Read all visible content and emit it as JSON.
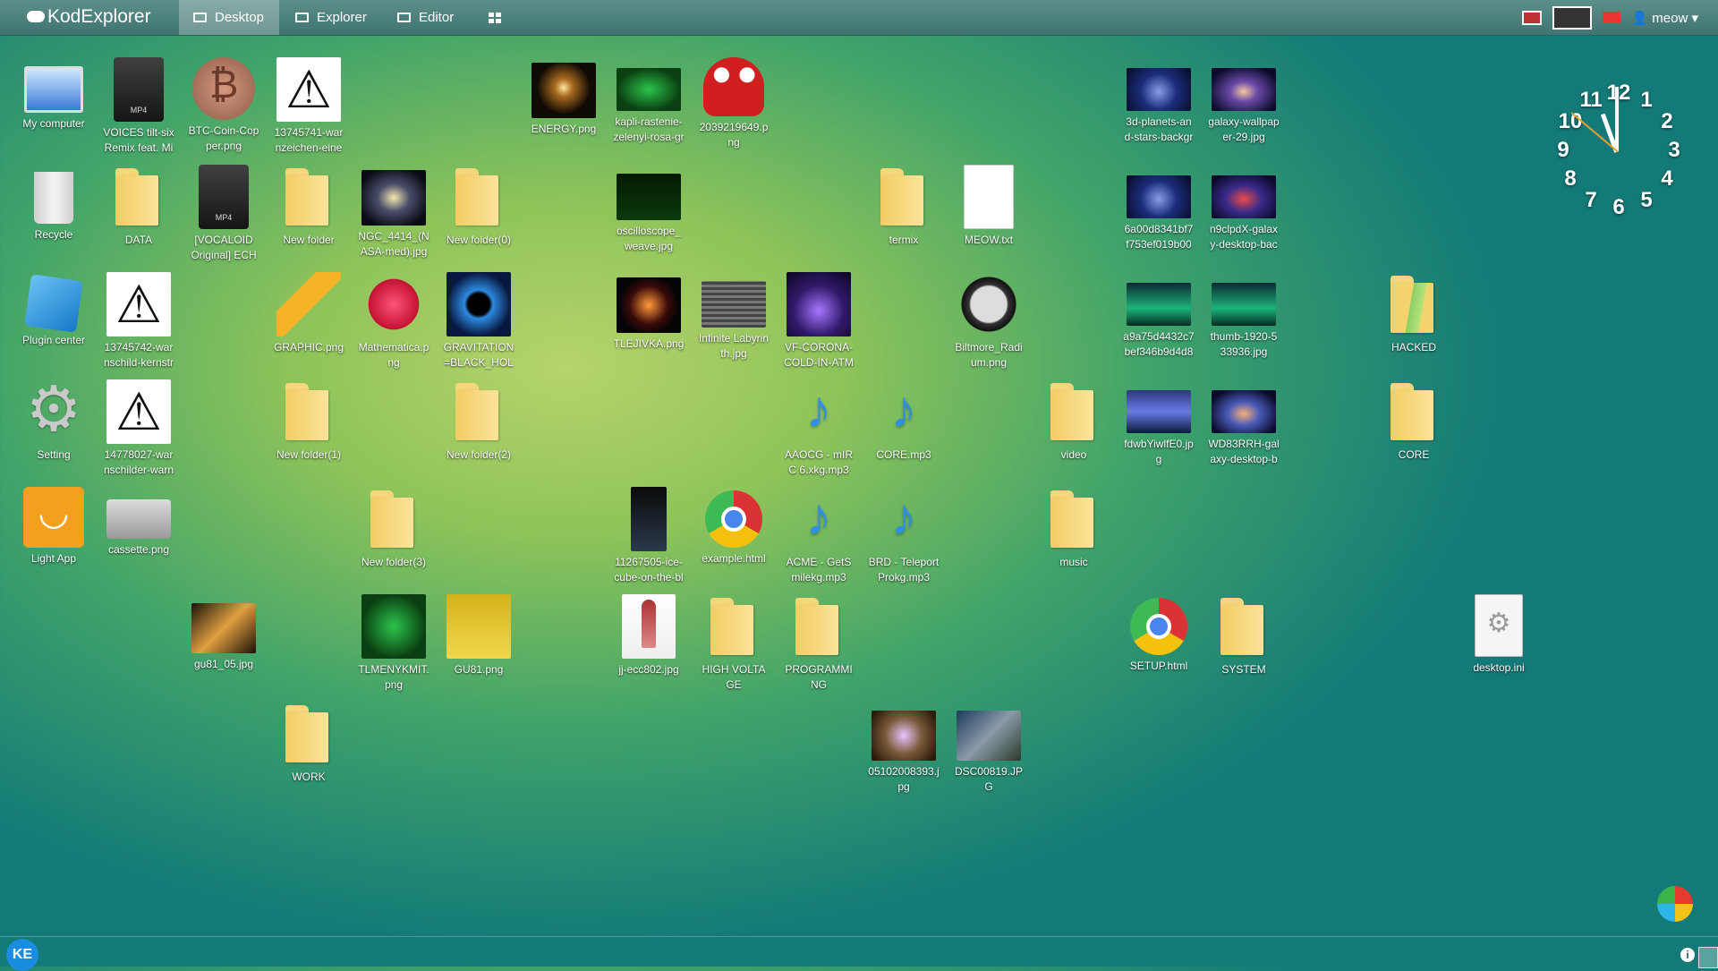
{
  "topbar": {
    "logo": "KodExplorer",
    "tabs": [
      {
        "label": "Desktop",
        "icon": "monitor-icon"
      },
      {
        "label": "Explorer",
        "icon": "drive-icon"
      },
      {
        "label": "Editor",
        "icon": "edit-icon"
      }
    ],
    "user": "meow"
  },
  "icons": {
    "c1": [
      "My computer",
      "Recycle",
      "Plugin center",
      "Setting",
      "Light App"
    ],
    "c2": [
      "VOICES tilt-six\nRemix feat. Mi",
      "DATA",
      "13745742-war\nnschild-kernstr",
      "14778027-war\nnschilder-warn",
      "cassette.png"
    ],
    "c3": [
      "BTC-Coin-Cop\nper.png",
      "[VOCALOID\nOriginal] ECH",
      "gu81_05.jpg"
    ],
    "c4": [
      "13745741-war\nnzeichen-eine",
      "New folder",
      "GRAPHIC.png",
      "New folder(1)",
      "WORK"
    ],
    "c5": [
      "NGC_4414_(N\nASA-med).jpg",
      "Mathematica.p\nng",
      "New folder(3)",
      "TLMENYKMIT.\npng"
    ],
    "c6": [
      "New folder(0)",
      "GRAVITATION\n=BLACK_HOL",
      "New folder(2)",
      "GU81.png"
    ],
    "c7": [
      "ENERGY.png"
    ],
    "c8": [
      "kapli-rastenie-\nzelenyi-rosa-gr",
      "oscilloscope_\nweave.jpg",
      "TLEJIVKA.png",
      "11267505-ice-\ncube-on-the-bl",
      "jj-ecc802.jpg"
    ],
    "c9": [
      "2039219649.p\nng",
      "Infinite Labyrin\nth.jpg",
      "example.html",
      "HIGH VOLTA\nGE"
    ],
    "c10": [
      "VF-CORONA-\nCOLD-IN-ATM",
      "AAOCG - mIR\nC 6.xkg.mp3",
      "ACME - GetS\nmilekg.mp3",
      "PROGRAMMI\nNG"
    ],
    "c11": [
      "termix",
      "CORE.mp3",
      "BRD - Teleport\nProkg.mp3",
      "05102008393.j\npg"
    ],
    "c12": [
      "MEOW.txt",
      "Biltmore_Radi\num.png",
      "DSC00819.JP\nG"
    ],
    "c13": [
      "video",
      "music"
    ],
    "c14": [
      "3d-planets-an\nd-stars-backgr",
      "6a00d8341bf7\nf753ef019b00",
      "a9a75d4432c7\nbef346b9d4d8",
      "fdwbYiwlfE0.jp\ng",
      "SETUP.html"
    ],
    "c15": [
      "galaxy-wallpap\ner-29.jpg",
      "n9clpdX-galax\ny-desktop-bac",
      "thumb-1920-5\n33936.jpg",
      "WD83RRH-gal\naxy-desktop-b",
      "SYSTEM"
    ],
    "c16": [
      "HACKED",
      "CORE"
    ],
    "c17": [
      "desktop.ini"
    ]
  },
  "clock": {
    "numbers": [
      "12",
      "1",
      "2",
      "3",
      "4",
      "5",
      "6",
      "7",
      "8",
      "9",
      "10",
      "11"
    ],
    "time": "11:59"
  },
  "statusbar": {
    "badge": "KE",
    "info": "i"
  }
}
